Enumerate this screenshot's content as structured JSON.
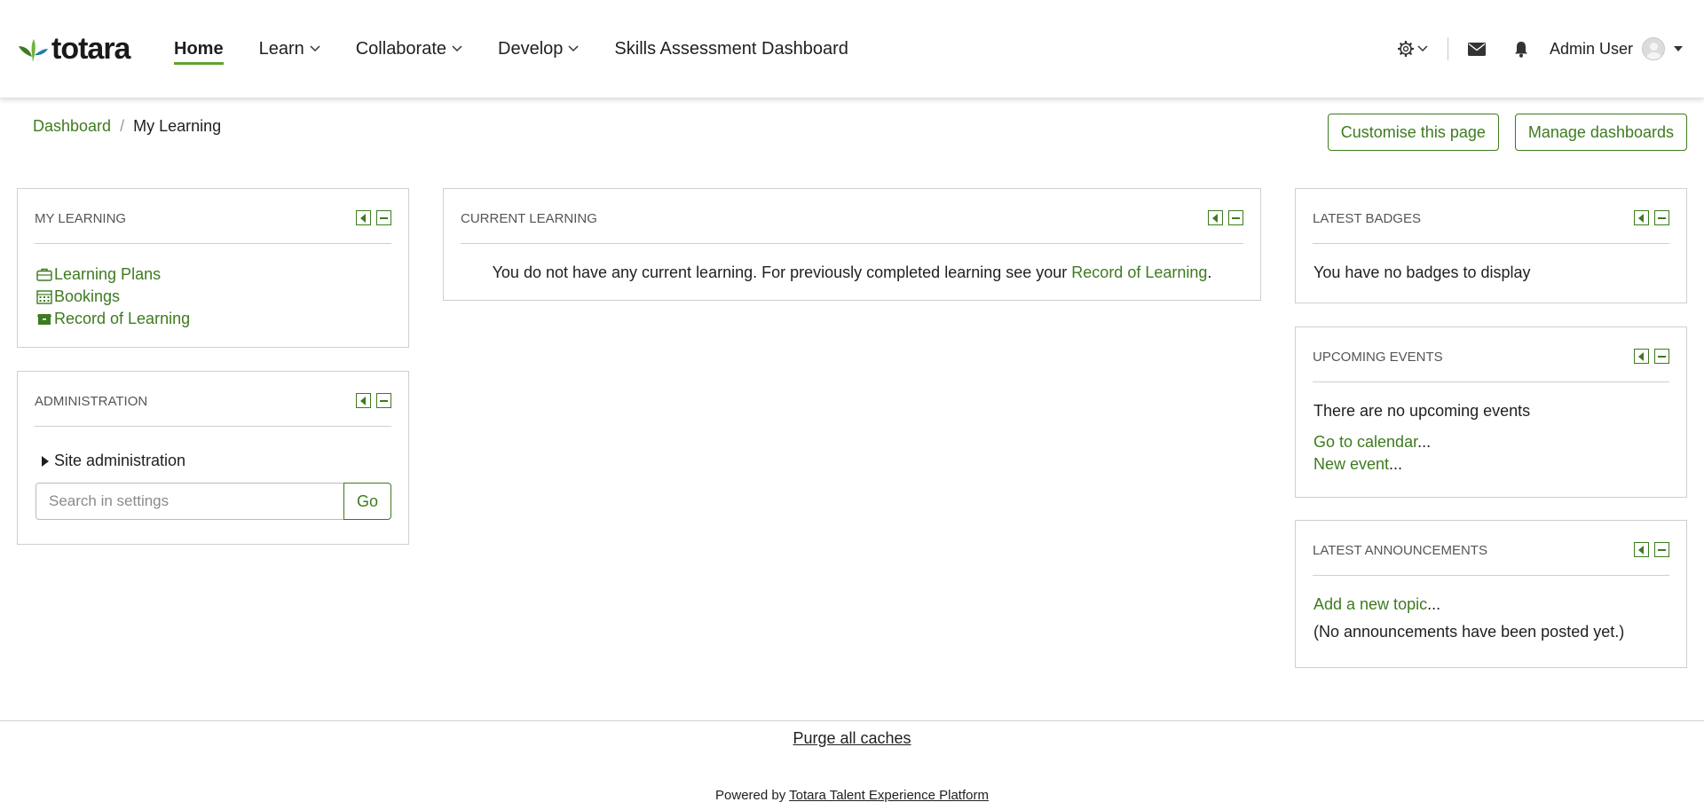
{
  "brand": {
    "name": "totara",
    "accent": "#3d7b1f",
    "nav_underline": "#5da431"
  },
  "nav": {
    "items": [
      {
        "label": "Home",
        "active": true
      },
      {
        "label": "Learn",
        "dropdown": true
      },
      {
        "label": "Collaborate",
        "dropdown": true
      },
      {
        "label": "Develop",
        "dropdown": true
      },
      {
        "label": "Skills Assessment Dashboard"
      }
    ],
    "icons": [
      "gear-icon",
      "envelope-icon",
      "bell-icon"
    ],
    "user_name": "Admin User"
  },
  "breadcrumb": {
    "root": "Dashboard",
    "separator": "/",
    "current": "My Learning"
  },
  "page_buttons": {
    "customise": "Customise this page",
    "manage": "Manage dashboards"
  },
  "blocks": {
    "my_learning": {
      "title": "MY LEARNING",
      "links": [
        "Learning Plans",
        "Bookings",
        "Record of Learning"
      ]
    },
    "administration": {
      "title": "ADMINISTRATION",
      "site_admin": "Site administration",
      "search_placeholder": "Search in settings",
      "go": "Go"
    },
    "current_learning": {
      "title": "CURRENT LEARNING",
      "message": "You do not have any current learning. For previously completed learning see your",
      "link": "Record of Learning",
      "message_end": "."
    },
    "latest_badges": {
      "title": "LATEST BADGES",
      "message": "You have no badges to display"
    },
    "upcoming_events": {
      "title": "UPCOMING EVENTS",
      "message": "There are no upcoming events",
      "calendar_link": "Go to calendar",
      "new_event_link": "New event",
      "ellipsis": "..."
    },
    "latest_announcements": {
      "title": "LATEST ANNOUNCEMENTS",
      "add_topic_link": "Add a new topic",
      "ellipsis": "...",
      "message": "(No announcements have been posted yet.)"
    }
  },
  "footer": {
    "purge": "Purge all caches",
    "powered_prefix": "Powered by",
    "powered_link": "Totara Talent Experience Platform"
  }
}
